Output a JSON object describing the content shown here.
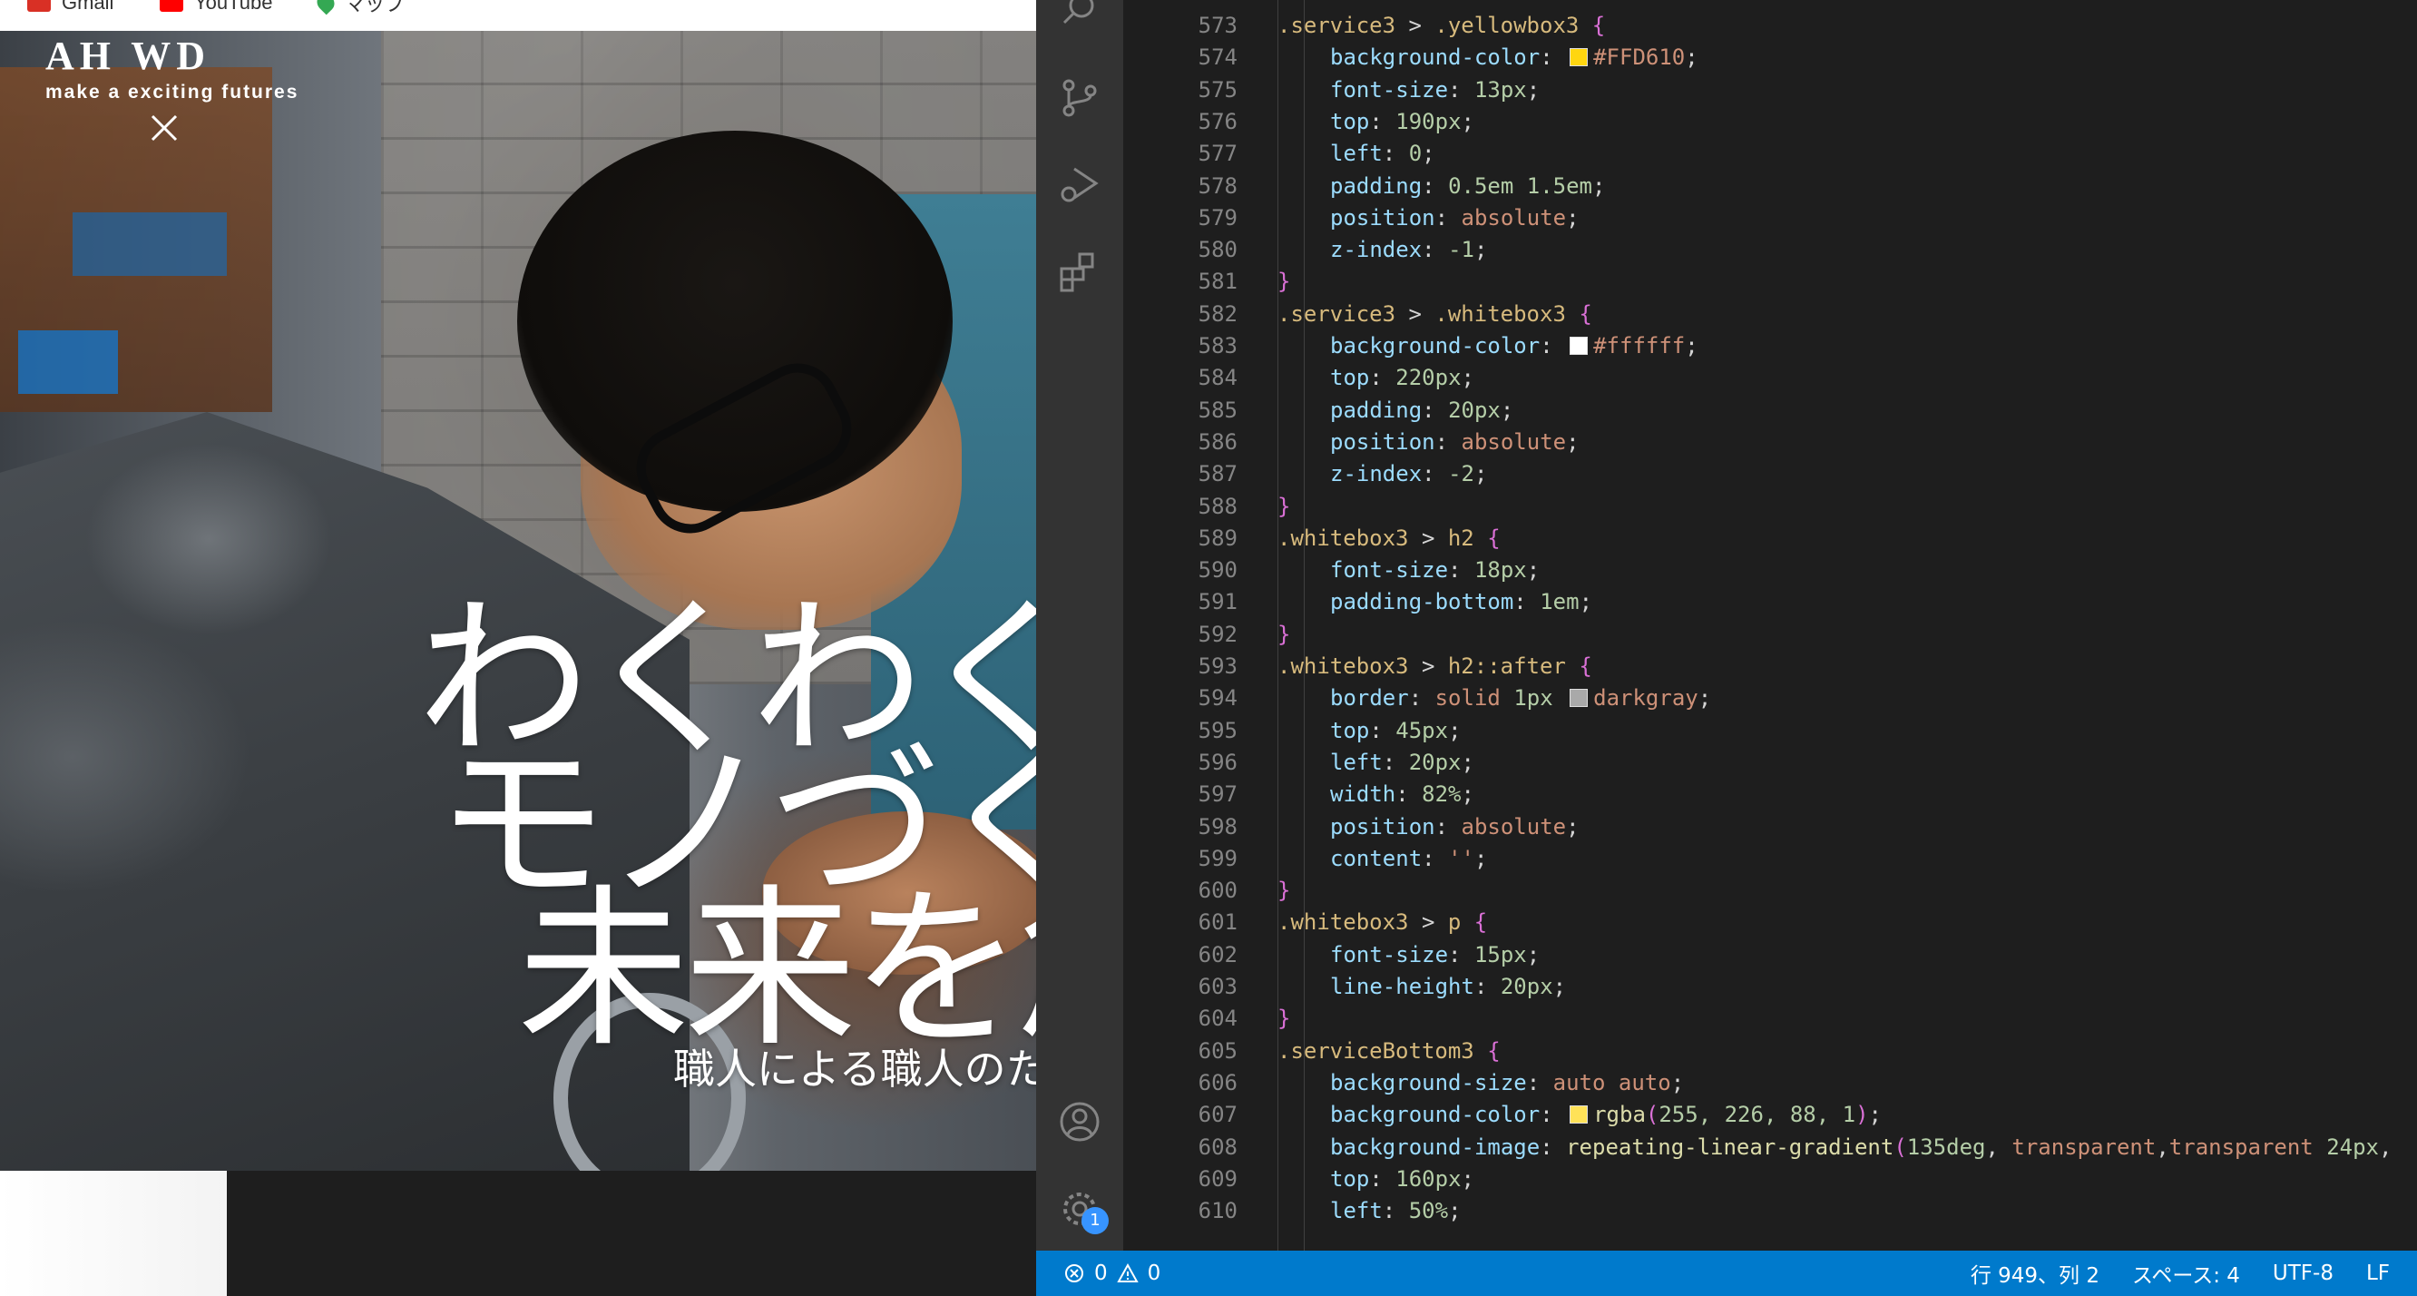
{
  "browser": {
    "bookmarks": [
      {
        "label": "Gmail",
        "color": "#d93025"
      },
      {
        "label": "YouTube",
        "color": "#ff0000"
      },
      {
        "label": "マップ",
        "color": "#34a853"
      }
    ],
    "site": {
      "logo": "AH WD",
      "tagline": "make a exciting futures",
      "hero_lines": [
        "わくわくす",
        "モノづくり",
        "未来を創"
      ],
      "hero_subtitle": "職人による職人のた"
    }
  },
  "vscode": {
    "activity_icons": [
      "search-icon",
      "source-control-icon",
      "run-debug-icon",
      "extensions-icon",
      "account-icon",
      "settings-gear-icon"
    ],
    "settings_badge": "1",
    "code_lines": [
      {
        "n": "573",
        "indent": 1,
        "tokens": [
          {
            "t": ".service3",
            "c": "sel"
          },
          {
            "t": " > ",
            "c": "op"
          },
          {
            "t": ".yellowbox3",
            "c": "sel"
          },
          {
            "t": " {",
            "c": "brace"
          }
        ]
      },
      {
        "n": "574",
        "indent": 2,
        "tokens": [
          {
            "t": "background-color",
            "c": "prop"
          },
          {
            "t": ": ",
            "c": "punc"
          },
          {
            "swatch": "#FFD610"
          },
          {
            "t": "#FFD610",
            "c": "val"
          },
          {
            "t": ";",
            "c": "punc"
          }
        ]
      },
      {
        "n": "575",
        "indent": 2,
        "tokens": [
          {
            "t": "font-size",
            "c": "prop"
          },
          {
            "t": ": ",
            "c": "punc"
          },
          {
            "t": "13px",
            "c": "num"
          },
          {
            "t": ";",
            "c": "punc"
          }
        ]
      },
      {
        "n": "576",
        "indent": 2,
        "tokens": [
          {
            "t": "top",
            "c": "prop"
          },
          {
            "t": ": ",
            "c": "punc"
          },
          {
            "t": "190px",
            "c": "num"
          },
          {
            "t": ";",
            "c": "punc"
          }
        ]
      },
      {
        "n": "577",
        "indent": 2,
        "tokens": [
          {
            "t": "left",
            "c": "prop"
          },
          {
            "t": ": ",
            "c": "punc"
          },
          {
            "t": "0",
            "c": "num"
          },
          {
            "t": ";",
            "c": "punc"
          }
        ]
      },
      {
        "n": "578",
        "indent": 2,
        "tokens": [
          {
            "t": "padding",
            "c": "prop"
          },
          {
            "t": ": ",
            "c": "punc"
          },
          {
            "t": "0.5em 1.5em",
            "c": "num"
          },
          {
            "t": ";",
            "c": "punc"
          }
        ]
      },
      {
        "n": "579",
        "indent": 2,
        "tokens": [
          {
            "t": "position",
            "c": "prop"
          },
          {
            "t": ": ",
            "c": "punc"
          },
          {
            "t": "absolute",
            "c": "val"
          },
          {
            "t": ";",
            "c": "punc"
          }
        ]
      },
      {
        "n": "580",
        "indent": 2,
        "tokens": [
          {
            "t": "z-index",
            "c": "prop"
          },
          {
            "t": ": ",
            "c": "punc"
          },
          {
            "t": "-1",
            "c": "num"
          },
          {
            "t": ";",
            "c": "punc"
          }
        ]
      },
      {
        "n": "581",
        "indent": 1,
        "tokens": [
          {
            "t": "}",
            "c": "brace"
          }
        ]
      },
      {
        "n": "582",
        "indent": 1,
        "tokens": [
          {
            "t": ".service3",
            "c": "sel"
          },
          {
            "t": " > ",
            "c": "op"
          },
          {
            "t": ".whitebox3",
            "c": "sel"
          },
          {
            "t": " {",
            "c": "brace"
          }
        ]
      },
      {
        "n": "583",
        "indent": 2,
        "tokens": [
          {
            "t": "background-color",
            "c": "prop"
          },
          {
            "t": ": ",
            "c": "punc"
          },
          {
            "swatch": "#ffffff"
          },
          {
            "t": "#ffffff",
            "c": "val"
          },
          {
            "t": ";",
            "c": "punc"
          }
        ]
      },
      {
        "n": "584",
        "indent": 2,
        "tokens": [
          {
            "t": "top",
            "c": "prop"
          },
          {
            "t": ": ",
            "c": "punc"
          },
          {
            "t": "220px",
            "c": "num"
          },
          {
            "t": ";",
            "c": "punc"
          }
        ]
      },
      {
        "n": "585",
        "indent": 2,
        "tokens": [
          {
            "t": "padding",
            "c": "prop"
          },
          {
            "t": ": ",
            "c": "punc"
          },
          {
            "t": "20px",
            "c": "num"
          },
          {
            "t": ";",
            "c": "punc"
          }
        ]
      },
      {
        "n": "586",
        "indent": 2,
        "tokens": [
          {
            "t": "position",
            "c": "prop"
          },
          {
            "t": ": ",
            "c": "punc"
          },
          {
            "t": "absolute",
            "c": "val"
          },
          {
            "t": ";",
            "c": "punc"
          }
        ]
      },
      {
        "n": "587",
        "indent": 2,
        "tokens": [
          {
            "t": "z-index",
            "c": "prop"
          },
          {
            "t": ": ",
            "c": "punc"
          },
          {
            "t": "-2",
            "c": "num"
          },
          {
            "t": ";",
            "c": "punc"
          }
        ]
      },
      {
        "n": "588",
        "indent": 1,
        "tokens": [
          {
            "t": "}",
            "c": "brace"
          }
        ]
      },
      {
        "n": "589",
        "indent": 1,
        "tokens": [
          {
            "t": ".whitebox3",
            "c": "sel"
          },
          {
            "t": " > ",
            "c": "op"
          },
          {
            "t": "h2",
            "c": "sel"
          },
          {
            "t": " {",
            "c": "brace"
          }
        ]
      },
      {
        "n": "590",
        "indent": 2,
        "tokens": [
          {
            "t": "font-size",
            "c": "prop"
          },
          {
            "t": ": ",
            "c": "punc"
          },
          {
            "t": "18px",
            "c": "num"
          },
          {
            "t": ";",
            "c": "punc"
          }
        ]
      },
      {
        "n": "591",
        "indent": 2,
        "tokens": [
          {
            "t": "padding-bottom",
            "c": "prop"
          },
          {
            "t": ": ",
            "c": "punc"
          },
          {
            "t": "1em",
            "c": "num"
          },
          {
            "t": ";",
            "c": "punc"
          }
        ]
      },
      {
        "n": "592",
        "indent": 1,
        "tokens": [
          {
            "t": "}",
            "c": "brace"
          }
        ]
      },
      {
        "n": "593",
        "indent": 1,
        "tokens": [
          {
            "t": ".whitebox3",
            "c": "sel"
          },
          {
            "t": " > ",
            "c": "op"
          },
          {
            "t": "h2::after",
            "c": "sel"
          },
          {
            "t": " {",
            "c": "brace"
          }
        ]
      },
      {
        "n": "594",
        "indent": 2,
        "tokens": [
          {
            "t": "border",
            "c": "prop"
          },
          {
            "t": ": ",
            "c": "punc"
          },
          {
            "t": "solid ",
            "c": "val"
          },
          {
            "t": "1px",
            "c": "num"
          },
          {
            "t": " ",
            "c": "punc"
          },
          {
            "swatch": "#a9a9a9"
          },
          {
            "t": "darkgray",
            "c": "val"
          },
          {
            "t": ";",
            "c": "punc"
          }
        ]
      },
      {
        "n": "595",
        "indent": 2,
        "tokens": [
          {
            "t": "top",
            "c": "prop"
          },
          {
            "t": ": ",
            "c": "punc"
          },
          {
            "t": "45px",
            "c": "num"
          },
          {
            "t": ";",
            "c": "punc"
          }
        ]
      },
      {
        "n": "596",
        "indent": 2,
        "tokens": [
          {
            "t": "left",
            "c": "prop"
          },
          {
            "t": ": ",
            "c": "punc"
          },
          {
            "t": "20px",
            "c": "num"
          },
          {
            "t": ";",
            "c": "punc"
          }
        ]
      },
      {
        "n": "597",
        "indent": 2,
        "tokens": [
          {
            "t": "width",
            "c": "prop"
          },
          {
            "t": ": ",
            "c": "punc"
          },
          {
            "t": "82%",
            "c": "num"
          },
          {
            "t": ";",
            "c": "punc"
          }
        ]
      },
      {
        "n": "598",
        "indent": 2,
        "tokens": [
          {
            "t": "position",
            "c": "prop"
          },
          {
            "t": ": ",
            "c": "punc"
          },
          {
            "t": "absolute",
            "c": "val"
          },
          {
            "t": ";",
            "c": "punc"
          }
        ]
      },
      {
        "n": "599",
        "indent": 2,
        "tokens": [
          {
            "t": "content",
            "c": "prop"
          },
          {
            "t": ": ",
            "c": "punc"
          },
          {
            "t": "''",
            "c": "val"
          },
          {
            "t": ";",
            "c": "punc"
          }
        ]
      },
      {
        "n": "600",
        "indent": 1,
        "tokens": [
          {
            "t": "}",
            "c": "brace"
          }
        ]
      },
      {
        "n": "601",
        "indent": 1,
        "tokens": [
          {
            "t": ".whitebox3",
            "c": "sel"
          },
          {
            "t": " > ",
            "c": "op"
          },
          {
            "t": "p",
            "c": "sel"
          },
          {
            "t": " {",
            "c": "brace"
          }
        ]
      },
      {
        "n": "602",
        "indent": 2,
        "tokens": [
          {
            "t": "font-size",
            "c": "prop"
          },
          {
            "t": ": ",
            "c": "punc"
          },
          {
            "t": "15px",
            "c": "num"
          },
          {
            "t": ";",
            "c": "punc"
          }
        ]
      },
      {
        "n": "603",
        "indent": 2,
        "tokens": [
          {
            "t": "line-height",
            "c": "prop"
          },
          {
            "t": ": ",
            "c": "punc"
          },
          {
            "t": "20px",
            "c": "num"
          },
          {
            "t": ";",
            "c": "punc"
          }
        ]
      },
      {
        "n": "604",
        "indent": 1,
        "tokens": [
          {
            "t": "}",
            "c": "brace"
          }
        ]
      },
      {
        "n": "605",
        "indent": 1,
        "tokens": [
          {
            "t": ".serviceBottom3",
            "c": "sel"
          },
          {
            "t": " {",
            "c": "brace"
          }
        ]
      },
      {
        "n": "606",
        "indent": 2,
        "tokens": [
          {
            "t": "background-size",
            "c": "prop"
          },
          {
            "t": ": ",
            "c": "punc"
          },
          {
            "t": "auto auto",
            "c": "val"
          },
          {
            "t": ";",
            "c": "punc"
          }
        ]
      },
      {
        "n": "607",
        "indent": 2,
        "tokens": [
          {
            "t": "background-color",
            "c": "prop"
          },
          {
            "t": ": ",
            "c": "punc"
          },
          {
            "swatch": "#ffe258"
          },
          {
            "t": "rgba",
            "c": "fn"
          },
          {
            "t": "(",
            "c": "brace"
          },
          {
            "t": "255, 226, 88, 1",
            "c": "num"
          },
          {
            "t": ")",
            "c": "brace"
          },
          {
            "t": ";",
            "c": "punc"
          }
        ]
      },
      {
        "n": "608",
        "indent": 2,
        "tokens": [
          {
            "t": "background-image",
            "c": "prop"
          },
          {
            "t": ": ",
            "c": "punc"
          },
          {
            "t": "repeating-linear-gradient",
            "c": "fn"
          },
          {
            "t": "(",
            "c": "brace"
          },
          {
            "t": "135deg",
            "c": "num"
          },
          {
            "t": ", ",
            "c": "punc"
          },
          {
            "t": "transparent",
            "c": "val"
          },
          {
            "t": ",",
            "c": "punc"
          },
          {
            "t": "transparent",
            "c": "val"
          },
          {
            "t": " 24px",
            "c": "num"
          },
          {
            "t": ",",
            "c": "punc"
          }
        ]
      },
      {
        "n": "609",
        "indent": 2,
        "tokens": [
          {
            "t": "top",
            "c": "prop"
          },
          {
            "t": ": ",
            "c": "punc"
          },
          {
            "t": "160px",
            "c": "num"
          },
          {
            "t": ";",
            "c": "punc"
          }
        ]
      },
      {
        "n": "610",
        "indent": 2,
        "tokens": [
          {
            "t": "left",
            "c": "prop"
          },
          {
            "t": ": ",
            "c": "punc"
          },
          {
            "t": "50%",
            "c": "num"
          },
          {
            "t": ";",
            "c": "punc"
          }
        ]
      }
    ],
    "status_bar": {
      "errors": "0",
      "warnings": "0",
      "cursor": "行 949、列 2",
      "indent": "スペース: 4",
      "encoding": "UTF-8",
      "eol": "LF"
    }
  }
}
